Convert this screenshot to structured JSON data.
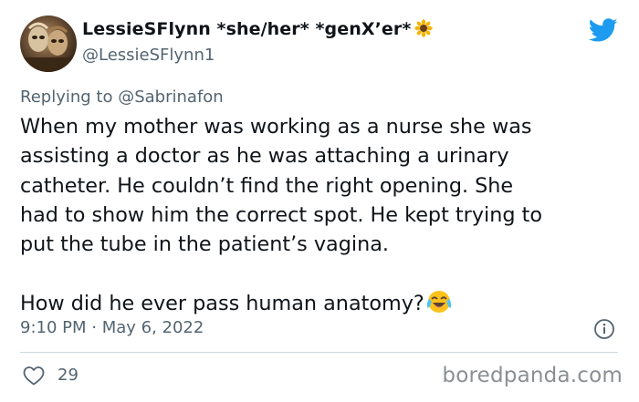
{
  "author": {
    "display_name": "LessieSFlynn *she/her* *genX’er*",
    "handle": "@LessieSFlynn1",
    "name_emoji": "sunflower-icon"
  },
  "reply": {
    "prefix": "Replying to",
    "mention": "@Sabrinafon"
  },
  "body": {
    "lines": [
      "When my mother was working as a nurse she was",
      "assisting a doctor as he was attaching a urinary",
      "catheter. He couldn’t find the right opening. She",
      "had to show him the correct spot. He kept trying to",
      "put the tube in the patient’s vagina."
    ],
    "closing": "How did he ever pass human anatomy?",
    "closing_emoji": "tears-of-joy-icon"
  },
  "meta": {
    "timestamp": "9:10 PM · May 6, 2022"
  },
  "engagement": {
    "likes": "29"
  },
  "watermark": "boredpanda.com",
  "colors": {
    "text": "#0f1419",
    "secondary": "#536471",
    "twitter_blue": "#1d9bf0",
    "divider": "#cfd9de"
  }
}
